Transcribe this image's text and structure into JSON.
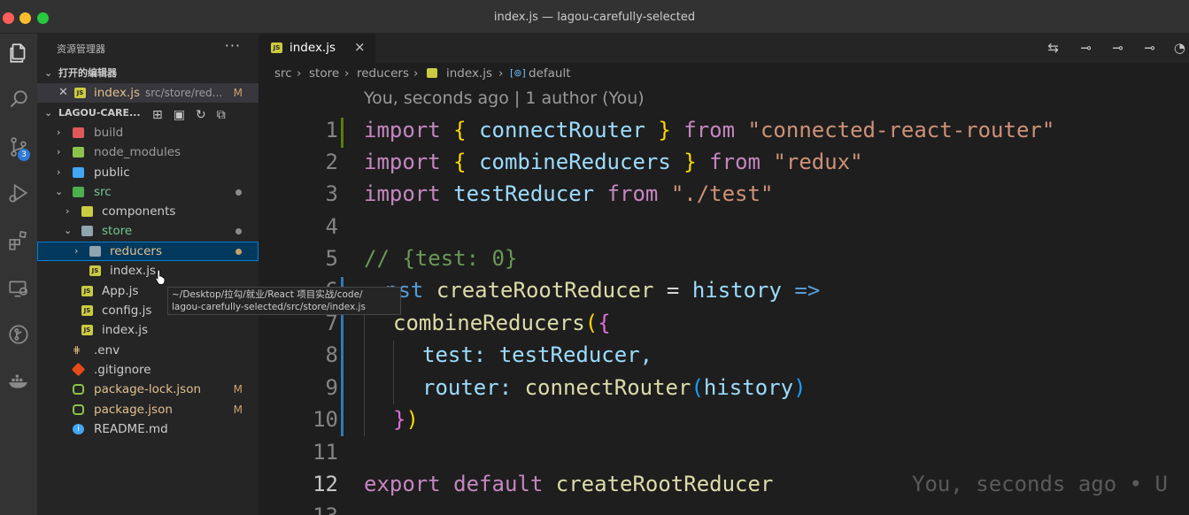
{
  "window": {
    "title": "index.js — lagou-carefully-selected"
  },
  "activity_bar": {
    "icons": [
      "files-icon",
      "search-icon",
      "source-control-icon",
      "run-debug-icon",
      "extensions-icon",
      "remote-explorer-icon",
      "git-graph-icon",
      "docker-icon"
    ],
    "source_control_badge": "3"
  },
  "sidebar": {
    "title": "资源管理器",
    "more": "···",
    "open_editors": {
      "header": "打开的编辑器",
      "items": [
        {
          "name": "index.js",
          "path": "src/store/red...",
          "status": "M"
        }
      ]
    },
    "project": {
      "header": "LAGOU-CARE...",
      "tree": [
        {
          "name": "build",
          "type": "folder"
        },
        {
          "name": "node_modules",
          "type": "folder"
        },
        {
          "name": "public",
          "type": "folder"
        },
        {
          "name": "src",
          "type": "folder"
        },
        {
          "name": "components",
          "type": "folder"
        },
        {
          "name": "store",
          "type": "folder"
        },
        {
          "name": "reducers",
          "type": "folder"
        },
        {
          "name": "index.js",
          "type": "js"
        },
        {
          "name": "App.js",
          "type": "js"
        },
        {
          "name": "config.js",
          "type": "js"
        },
        {
          "name": "index.js",
          "type": "js"
        },
        {
          "name": ".env",
          "type": "env"
        },
        {
          "name": ".gitignore",
          "type": "git"
        },
        {
          "name": "package-lock.json",
          "type": "node",
          "status": "M"
        },
        {
          "name": "package.json",
          "type": "node",
          "status": "M"
        },
        {
          "name": "README.md",
          "type": "info"
        }
      ]
    },
    "tooltip": {
      "line1": "~/Desktop/拉勾/就业/React 项目实战/code/",
      "line2": "lagou-carefully-selected/src/store/index.js"
    }
  },
  "editor": {
    "tab": {
      "name": "index.js",
      "close": "×",
      "icon": "JS"
    },
    "breadcrumb": [
      "src",
      "store",
      "reducers",
      "index.js",
      "default"
    ],
    "blame_header": "You, seconds ago | 1 author (You)",
    "line_numbers": [
      "1",
      "2",
      "3",
      "4",
      "5",
      "6",
      "7",
      "8",
      "9",
      "10",
      "11",
      "12",
      "13"
    ],
    "inline_blame": "You, seconds ago • U",
    "code": {
      "l1": {
        "kw": "import",
        "b1": "{",
        "name": "connectRouter",
        "b2": "}",
        "from": "from",
        "src": "\"connected-react-router\""
      },
      "l2": {
        "kw": "import",
        "b1": "{",
        "name": "combineReducers",
        "b2": "}",
        "from": "from",
        "src": "\"redux\""
      },
      "l3": {
        "kw": "import",
        "name": "testReducer",
        "from": "from",
        "src": "\"./test\""
      },
      "l5": {
        "comment": "// {test: 0}"
      },
      "l6": {
        "kw": "nst",
        "name": "createRootReducer",
        "op": "=",
        "param": "history",
        "arrow": "=>"
      },
      "l7": {
        "fn": "combineReducers",
        "p": "(",
        "b": "{"
      },
      "l8": {
        "key": "test:",
        "val": "testReducer,"
      },
      "l9": {
        "key": "router:",
        "fn": "connectRouter",
        "p1": "(",
        "arg": "history",
        "p2": ")"
      },
      "l10": {
        "b": "}",
        "p": ")"
      },
      "l12": {
        "kw1": "export",
        "kw2": "default",
        "name": "createRootReducer"
      }
    }
  }
}
